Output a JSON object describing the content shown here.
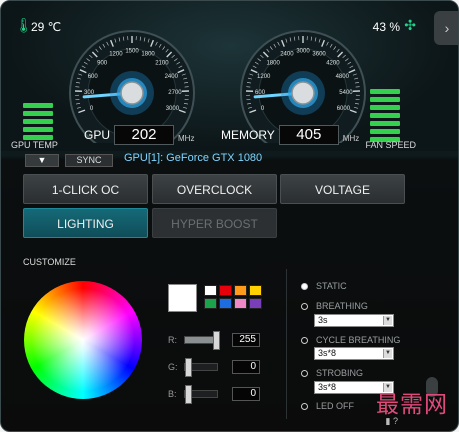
{
  "status": {
    "temperature": "29 ℃",
    "fan_percent": "43 %",
    "temp_icon": "thermometer-icon",
    "fan_icon": "fan-icon"
  },
  "gauges": {
    "gpu": {
      "label": "GPU",
      "value": "202",
      "unit": "MHz",
      "ticks": [
        "0",
        "300",
        "600",
        "900",
        "1200",
        "1500",
        "1800",
        "2100",
        "2400",
        "2700",
        "3000"
      ],
      "needle_fraction": 0.07
    },
    "memory": {
      "label": "MEMORY",
      "value": "405",
      "unit": "MHz",
      "ticks": [
        "0",
        "600",
        "1200",
        "1800",
        "2400",
        "3000",
        "3600",
        "4200",
        "4800",
        "5400",
        "6000"
      ],
      "needle_fraction": 0.07
    }
  },
  "side_labels": {
    "gpu_temp": "GPU TEMP",
    "fan_speed": "FAN SPEED"
  },
  "device": {
    "dropdown_icon": "▼",
    "sync_label": "SYNC",
    "gpu_name": "GPU[1]: GeForce GTX 1080"
  },
  "tabs": [
    {
      "label": "1-CLICK OC"
    },
    {
      "label": "OVERCLOCK"
    },
    {
      "label": "VOLTAGE"
    },
    {
      "label": "LIGHTING"
    },
    {
      "label": "HYPER BOOST"
    }
  ],
  "lighting": {
    "customize_label": "CUSTOMIZE",
    "selected_color": "#ffffff",
    "swatches": [
      "#ffffff",
      "#e8000b",
      "#ff9a1a",
      "#ffd200",
      "#1aa34a",
      "#1e6de0",
      "#f088c8",
      "#7a3fb8"
    ],
    "rgb": {
      "r_label": "R:",
      "r_value": "255",
      "g_label": "G:",
      "g_value": "0",
      "b_label": "B:",
      "b_value": "0"
    },
    "modes": {
      "static": "STATIC",
      "breathing": "BREATHING",
      "cycle": "CYCLE BREATHING",
      "strobing": "STROBING",
      "led_off": "LED OFF"
    },
    "selects": {
      "breathing": "3s",
      "cycle": "3s*8",
      "strobing": "3s*8"
    }
  },
  "colors": {
    "accent_green": "#35d04d",
    "active_tab": "#156a78",
    "gpu_name": "#7fd6ff"
  },
  "watermark": "最需网",
  "bottom_icons": "▮ ?"
}
